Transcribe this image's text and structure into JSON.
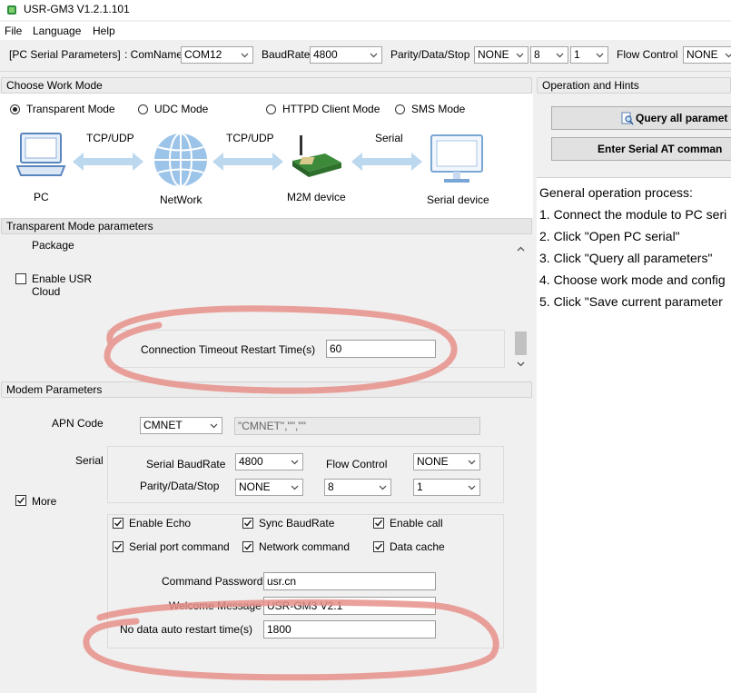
{
  "app": {
    "title": "USR-GM3 V1.2.1.101"
  },
  "menu": {
    "file": "File",
    "language": "Language",
    "help": "Help"
  },
  "toolbar": {
    "section_label": "[PC Serial Parameters]",
    "comname_label": ": ComName",
    "comname_value": "COM12",
    "baudrate_label": "BaudRate",
    "baudrate_value": "4800",
    "parity_label": "Parity/Data/Stop",
    "parity_value": "NONE",
    "data_value": "8",
    "stop_value": "1",
    "flow_label": "Flow Control",
    "flow_value": "NONE"
  },
  "work_mode": {
    "header": "Choose Work Mode",
    "modes": [
      "Transparent Mode",
      "UDC Mode",
      "HTTPD Client Mode",
      "SMS Mode"
    ],
    "selected_index": 0,
    "diagram": {
      "pc": "PC",
      "network": "NetWork",
      "m2m": "M2M device",
      "serial_device": "Serial device",
      "link1": "TCP/UDP",
      "link2": "TCP/UDP",
      "link3": "Serial"
    }
  },
  "transparent": {
    "header": "Transparent Mode parameters",
    "package_label": "Package",
    "enable_usr_cloud_line1": "Enable USR",
    "enable_usr_cloud_line2": "Cloud",
    "enable_usr_cloud_checked": false,
    "conn_timeout_label": "Connection Timeout Restart Time(s)",
    "conn_timeout_value": "60"
  },
  "modem": {
    "header": "Modem Parameters",
    "apn_label": "APN Code",
    "apn_value": "CMNET",
    "apn_string": "\"CMNET\",\"\",\"\"",
    "serial_label": "Serial",
    "serial_baudrate_label": "Serial BaudRate",
    "serial_baudrate_value": "4800",
    "flow_control_label": "Flow Control",
    "flow_control_value": "NONE",
    "parity_label": "Parity/Data/Stop",
    "parity_value": "NONE",
    "data_value": "8",
    "stop_value": "1",
    "more_label": "More",
    "more_checked": true,
    "options": [
      {
        "label": "Enable Echo",
        "checked": true
      },
      {
        "label": "Sync BaudRate",
        "checked": true
      },
      {
        "label": "Enable call",
        "checked": true
      },
      {
        "label": "Serial port command",
        "checked": true
      },
      {
        "label": "Network command",
        "checked": true
      },
      {
        "label": "Data cache",
        "checked": true
      }
    ],
    "cmd_password_label": "Command Password",
    "cmd_password_value": "usr.cn",
    "welcome_label": "Welcome Message",
    "welcome_value": "USR-GM3 V2.1",
    "no_data_label": "No data auto restart time(s)",
    "no_data_value": "1800"
  },
  "hints": {
    "header": "Operation and Hints",
    "query_button": "Query all paramet",
    "enter_at_button": "Enter Serial AT comman",
    "lines": [
      "General operation process:",
      "1. Connect the module to PC seri",
      "2. Click \"Open PC serial\"",
      "3. Click \"Query all parameters\"",
      "4. Choose work mode and config",
      "5. Click \"Save current parameter"
    ]
  },
  "colors": {
    "annotation": "#e8908a",
    "arrow": "#bcd8ee",
    "globe": "#9cc4e8"
  }
}
